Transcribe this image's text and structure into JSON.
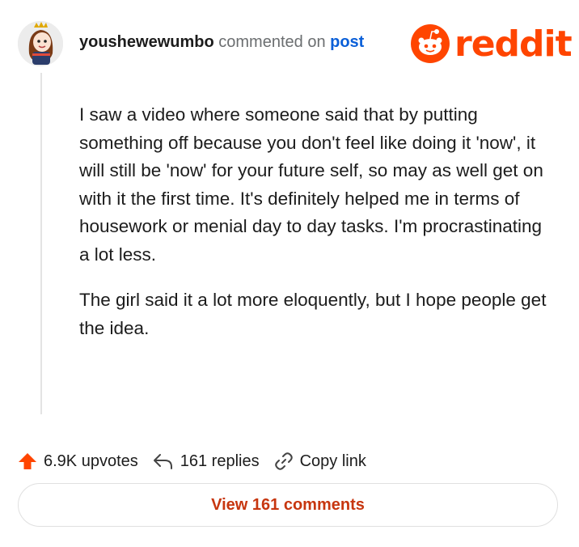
{
  "comment": {
    "username": "youshewewumbo",
    "action_text": "commented on",
    "post_link_text": "post",
    "paragraphs": [
      "I saw a video where someone said that by putting something off because you don't feel like doing it 'now', it will still be 'now' for your future self, so may as well get on with it the first time. It's definitely helped me in terms of housework or menial day to day tasks. I'm procrastinating a lot less.",
      "The girl said it a lot more eloquently, but I hope people get the idea."
    ]
  },
  "brand": {
    "logo_text": "reddit",
    "logo_icon": "reddit-snoo-icon",
    "color": "#ff4500"
  },
  "actions": {
    "upvotes": "6.9K upvotes",
    "replies": "161 replies",
    "copy_link": "Copy link",
    "upvote_icon": "upvote-arrow-icon",
    "reply_icon": "reply-arrow-icon",
    "link_icon": "link-icon",
    "upvote_color": "#ff4500"
  },
  "view_comments": {
    "label": "View 161 comments",
    "color": "#c7360f"
  }
}
